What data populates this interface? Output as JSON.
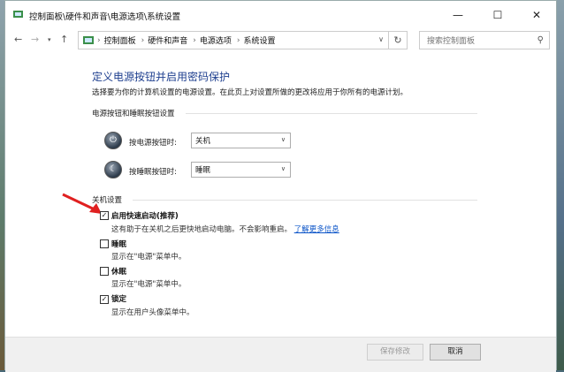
{
  "window": {
    "title": "控制面板\\硬件和声音\\电源选项\\系统设置",
    "minimize_label": "—",
    "maximize_label": "☐",
    "close_label": "✕"
  },
  "address": {
    "crumbs": [
      "控制面板",
      "硬件和声音",
      "电源选项",
      "系统设置"
    ],
    "search_placeholder": "搜索控制面板"
  },
  "main": {
    "title": "定义电源按钮并启用密码保护",
    "description": "选择要为你的计算机设置的电源设置。在此页上对设置所做的更改将应用于你所有的电源计划。",
    "power_group": {
      "label": "电源按钮和睡眠按钮设置",
      "power_button_label": "按电源按钮时:",
      "power_button_value": "关机",
      "sleep_button_label": "按睡眠按钮时:",
      "sleep_button_value": "睡眠"
    },
    "shutdown_group": {
      "label": "关机设置",
      "items": [
        {
          "label": "启用快速启动(推荐)",
          "desc": "这有助于在关机之后更快地启动电脑。不会影响重启。",
          "link": "了解更多信息",
          "checked": true
        },
        {
          "label": "睡眠",
          "desc": "显示在\"电源\"菜单中。",
          "checked": false
        },
        {
          "label": "休眠",
          "desc": "显示在\"电源\"菜单中。",
          "checked": false
        },
        {
          "label": "锁定",
          "desc": "显示在用户头像菜单中。",
          "checked": true
        }
      ]
    }
  },
  "footer": {
    "save_label": "保存修改",
    "cancel_label": "取消"
  },
  "colors": {
    "title_blue": "#1e3f8f",
    "link_blue": "#0b54c8",
    "arrow_red": "#e02020"
  }
}
